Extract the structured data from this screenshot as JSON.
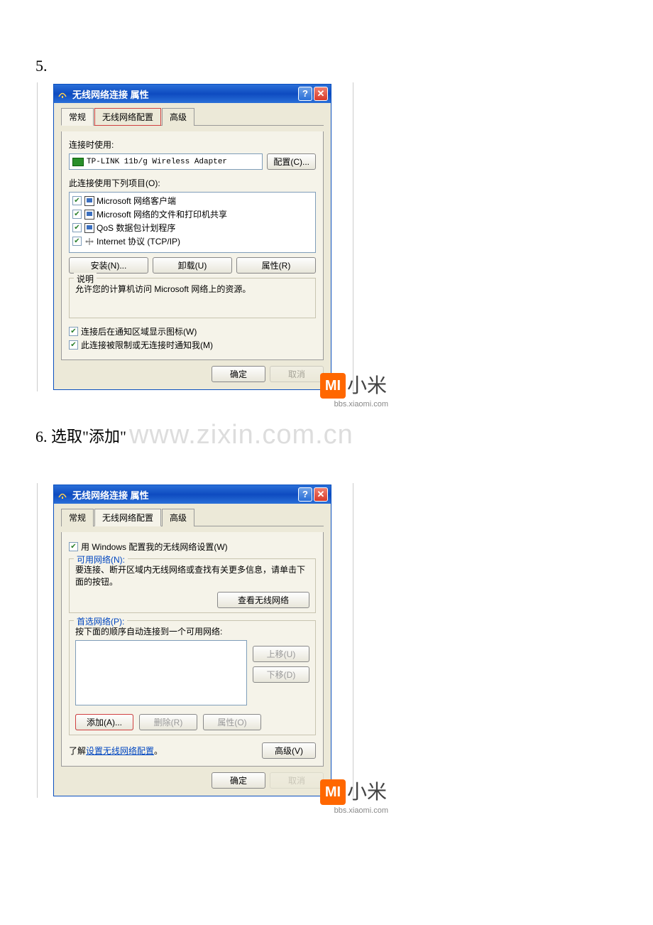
{
  "steps": {
    "s5": "5.",
    "s6": "6. 选取\"添加\""
  },
  "watermark_url": "www.zixin.com.cn",
  "watermark_logo": {
    "mi": "MI",
    "text": "小米",
    "url": "bbs.xiaomi.com"
  },
  "dialog": {
    "title": "无线网络连接 属性",
    "tabs": {
      "general": "常规",
      "wireless": "无线网络配置",
      "advanced": "高级"
    },
    "general": {
      "connect_using": "连接时使用:",
      "adapter": "TP-LINK 11b/g Wireless Adapter",
      "configure_btn": "配置(C)...",
      "uses_items": "此连接使用下列项目(O):",
      "items": [
        "Microsoft 网络客户端",
        "Microsoft 网络的文件和打印机共享",
        "QoS 数据包计划程序",
        "Internet 协议 (TCP/IP)"
      ],
      "install_btn": "安装(N)...",
      "uninstall_btn": "卸载(U)",
      "props_btn": "属性(R)",
      "desc_legend": "说明",
      "desc_text": "允许您的计算机访问 Microsoft 网络上的资源。",
      "show_icon": "连接后在通知区域显示图标(W)",
      "notify_me": "此连接被限制或无连接时通知我(M)"
    },
    "wireless": {
      "use_windows": "用 Windows 配置我的无线网络设置(W)",
      "avail_legend": "可用网络(N):",
      "avail_text": "要连接、断开区域内无线网络或查找有关更多信息，请单击下面的按钮。",
      "view_btn": "查看无线网络",
      "pref_legend": "首选网络(P):",
      "pref_text": "按下面的顺序自动连接到一个可用网络:",
      "moveup_btn": "上移(U)",
      "movedown_btn": "下移(D)",
      "add_btn": "添加(A)...",
      "remove_btn": "删除(R)",
      "props_btn": "属性(O)",
      "learn_prefix": "了解",
      "learn_link": "设置无线网络配置",
      "learn_suffix": "。",
      "adv_btn": "高级(V)"
    },
    "ok_btn": "确定",
    "cancel_btn": "取消"
  }
}
